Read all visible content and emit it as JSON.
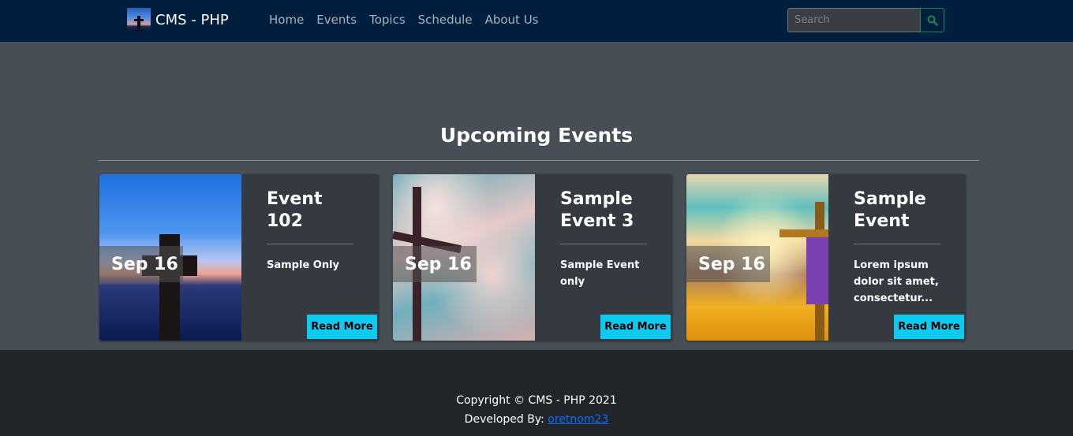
{
  "navbar": {
    "brand": "CMS - PHP",
    "links": [
      "Home",
      "Events",
      "Topics",
      "Schedule",
      "About Us"
    ],
    "search_placeholder": "Search",
    "search_value": ""
  },
  "main": {
    "title": "Upcoming Events",
    "events": [
      {
        "title": "Event 102",
        "date": "Sep 16",
        "description": "Sample Only",
        "button": "Read More"
      },
      {
        "title": "Sample Event 3",
        "date": "Sep 16",
        "description": "Sample Event only",
        "button": "Read More"
      },
      {
        "title": "Sample Event",
        "date": "Sep 16",
        "description": "Lorem ipsum dolor sit amet, consectetur...",
        "button": "Read More"
      }
    ]
  },
  "footer": {
    "copyright": "Copyright © CMS - PHP 2021",
    "developed_label": "Developed By: ",
    "developer": "oretnom23"
  },
  "colors": {
    "navbar_bg": "#001f3f",
    "accent_button": "#0dcaf0",
    "search_button": "#198754",
    "link": "#0d6efd"
  }
}
